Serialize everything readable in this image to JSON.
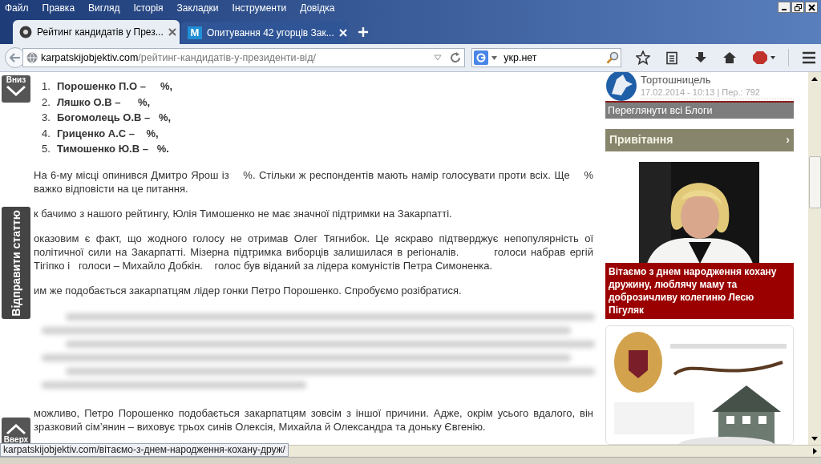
{
  "menu": [
    "Файл",
    "Правка",
    "Вигляд",
    "Історія",
    "Закладки",
    "Інструменти",
    "Довідка"
  ],
  "tabs": [
    {
      "title": "Рейтинг кандидатів у През...",
      "selected": true,
      "kind": "aperture"
    },
    {
      "title": "Опитування 42 угорців Зак...",
      "selected": false,
      "kind": "letter"
    }
  ],
  "tab_letter": "M",
  "address": {
    "domain": "karpatskijobjektiv.com",
    "path": "/рейтинг-кандидатів-у-президенти-від/"
  },
  "search": {
    "value": "укр.нет"
  },
  "article": {
    "list": [
      {
        "number": "1.",
        "text": "Порошенко П.О –     %,"
      },
      {
        "number": "2.",
        "text": "Ляшко О.В –      %,"
      },
      {
        "number": "3.",
        "text": "Богомолець О.В –   %,"
      },
      {
        "number": "4.",
        "text": "Гриценко А.С –    %,"
      },
      {
        "number": "5.",
        "text": "Тимошенко Ю.В –   %."
      }
    ],
    "paragraphs": [
      {
        "kind": "text",
        "text": "На 6-му місці опинився Дмитро Ярош із    %. Стільки ж респондентів мають намір голосувати проти всіх. Ще    % важко відповісти на це питання."
      },
      {
        "kind": "text",
        "text": "к бачимо з нашого рейтингу, Юлія Тимошенко не має значної підтримки на Закарпатті."
      },
      {
        "kind": "text",
        "text": "оказовим є факт, що жодного голосу не отримав Олег Тягнибок. Це яскраво підтверджує непопулярність ої політичної сили на Закарпатті. Мізерна підтримка виборців залишилася в регіоналів.        голоси набрав ергій Тігіпко і   голоси – Михайло Добкін.    голос був віданий за лідера комуністів Петра Симоненка."
      },
      {
        "kind": "text",
        "text": "им же подобається закарпатцям лідер гонки Петро Порошенко. Спробуємо розібратися."
      },
      {
        "kind": "blurred"
      },
      {
        "kind": "text",
        "text": "можливо, Петро Порошенко подобається закарпатцям зовсім з іншої причини. Адже, окрім усього вдалого, він зразковий сім’янин – виховує трьох синів Олексія, Михайла й Олександра та доньку Євгенію."
      }
    ]
  },
  "float_buttons": {
    "down": "Вниз",
    "send": "Відправити статтю",
    "up": "Вверх"
  },
  "sidebar": {
    "blog_author": "Тортошницель",
    "blog_meta": "17.02.2014 - 10:13 | Пер.: 792",
    "all_blogs": "Переглянути всі Блоги",
    "section": {
      "title": "Привітання",
      "arrow": "›"
    },
    "greeting": "Вітаємо з днем народження кохану дружину, люблячу маму та доброзичливу колегиню Лесю Пігуляк"
  },
  "status_url": "karpatskijobjektiv.com/вітаємо-з-днем-народження-кохану-друж/"
}
